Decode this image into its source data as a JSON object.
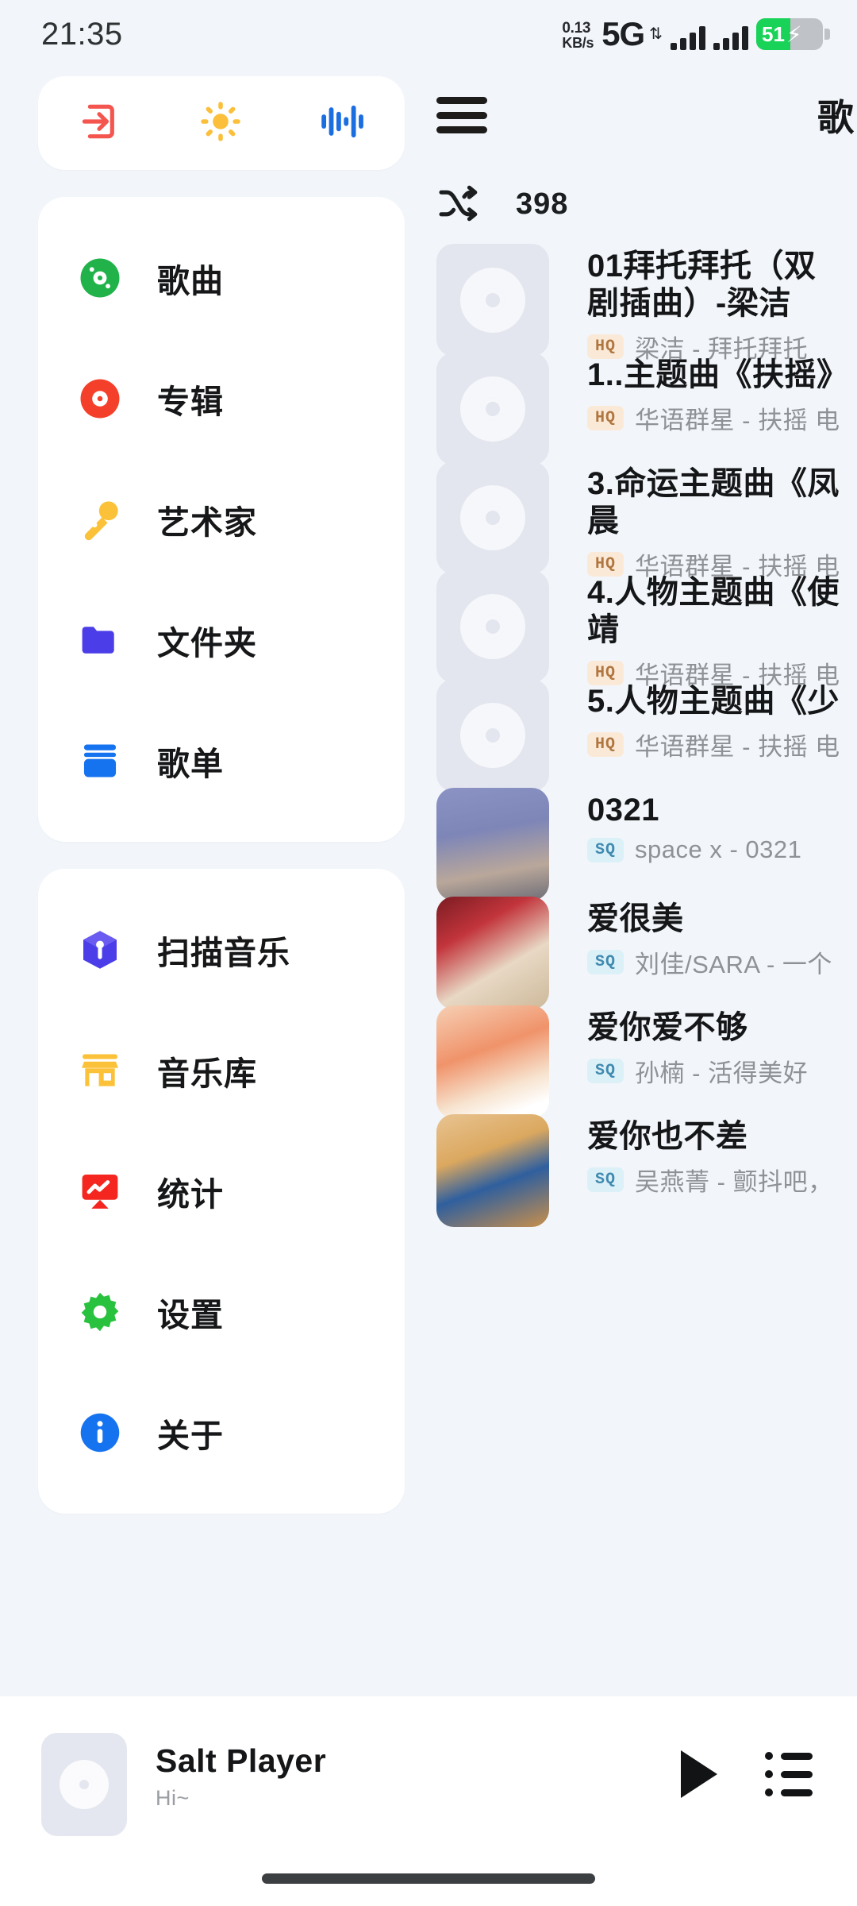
{
  "status_bar": {
    "time": "21:35",
    "net_speed_value": "0.13",
    "net_speed_unit": "KB/s",
    "network_type": "5G",
    "battery_percent": "51",
    "battery_level": 51,
    "charging": true
  },
  "sidebar": {
    "quick_actions": [
      {
        "name": "exit-icon",
        "label": "退出",
        "color": "#f4554f"
      },
      {
        "name": "theme-icon",
        "label": "主题",
        "color": "#fbbf3b"
      },
      {
        "name": "equalizer-icon",
        "label": "音效",
        "color": "#1a6ee0"
      }
    ],
    "nav_primary": [
      {
        "label": "歌曲",
        "icon": "disc-green-icon",
        "color": "#21b34a"
      },
      {
        "label": "专辑",
        "icon": "disc-red-icon",
        "color": "#f4402a"
      },
      {
        "label": "艺术家",
        "icon": "microphone-icon",
        "color": "#fbc138"
      },
      {
        "label": "文件夹",
        "icon": "folder-icon",
        "color": "#4b3ee8"
      },
      {
        "label": "歌单",
        "icon": "playlist-jar-icon",
        "color": "#1673f0"
      }
    ],
    "nav_secondary": [
      {
        "label": "扫描音乐",
        "icon": "scan-cube-icon",
        "color": "#4b3ee8"
      },
      {
        "label": "音乐库",
        "icon": "store-icon",
        "color": "#fbc138"
      },
      {
        "label": "统计",
        "icon": "chart-board-icon",
        "color": "#f4261f"
      },
      {
        "label": "设置",
        "icon": "gear-icon",
        "color": "#29c23f"
      },
      {
        "label": "关于",
        "icon": "info-icon",
        "color": "#1673f0"
      }
    ]
  },
  "content": {
    "page_title": "歌曲",
    "menu_icon": "hamburger-icon",
    "shuffle_icon": "shuffle-icon",
    "song_count": "398",
    "songs": [
      {
        "title": "01拜托拜托（双\n剧插曲）-梁洁",
        "quality": "HQ",
        "quality_kind": "hq",
        "subtitle": "梁洁 - 拜托拜托",
        "art": "placeholder"
      },
      {
        "title": "1..主题曲《扶摇》",
        "quality": "HQ",
        "quality_kind": "hq",
        "subtitle": "华语群星 - 扶摇 电",
        "art": "placeholder"
      },
      {
        "title": "3.命运主题曲《凤\n晨",
        "quality": "HQ",
        "quality_kind": "hq",
        "subtitle": "华语群星 - 扶摇 电",
        "art": "placeholder"
      },
      {
        "title": "4.人物主题曲《使\n靖",
        "quality": "HQ",
        "quality_kind": "hq",
        "subtitle": "华语群星 - 扶摇 电",
        "art": "placeholder"
      },
      {
        "title": "5.人物主题曲《少",
        "quality": "HQ",
        "quality_kind": "hq",
        "subtitle": "华语群星 - 扶摇 电",
        "art": "placeholder"
      },
      {
        "title": "0321",
        "quality": "SQ",
        "quality_kind": "sq",
        "subtitle": "space x - 0321",
        "art": "img0321"
      },
      {
        "title": "爱很美",
        "quality": "SQ",
        "quality_kind": "sq",
        "subtitle": "刘佳/SARA - 一个",
        "art": "imglove"
      },
      {
        "title": "爱你爱不够",
        "quality": "SQ",
        "quality_kind": "sq",
        "subtitle": "孙楠 - 活得美好",
        "art": "imgsun"
      },
      {
        "title": "爱你也不差",
        "quality": "SQ",
        "quality_kind": "sq",
        "subtitle": "吴燕菁 - 颤抖吧，",
        "art": "imgdrama"
      }
    ]
  },
  "player": {
    "track_title": "Salt Player",
    "track_subtitle": "Hi~",
    "play_icon": "play-icon",
    "queue_icon": "queue-list-icon"
  }
}
